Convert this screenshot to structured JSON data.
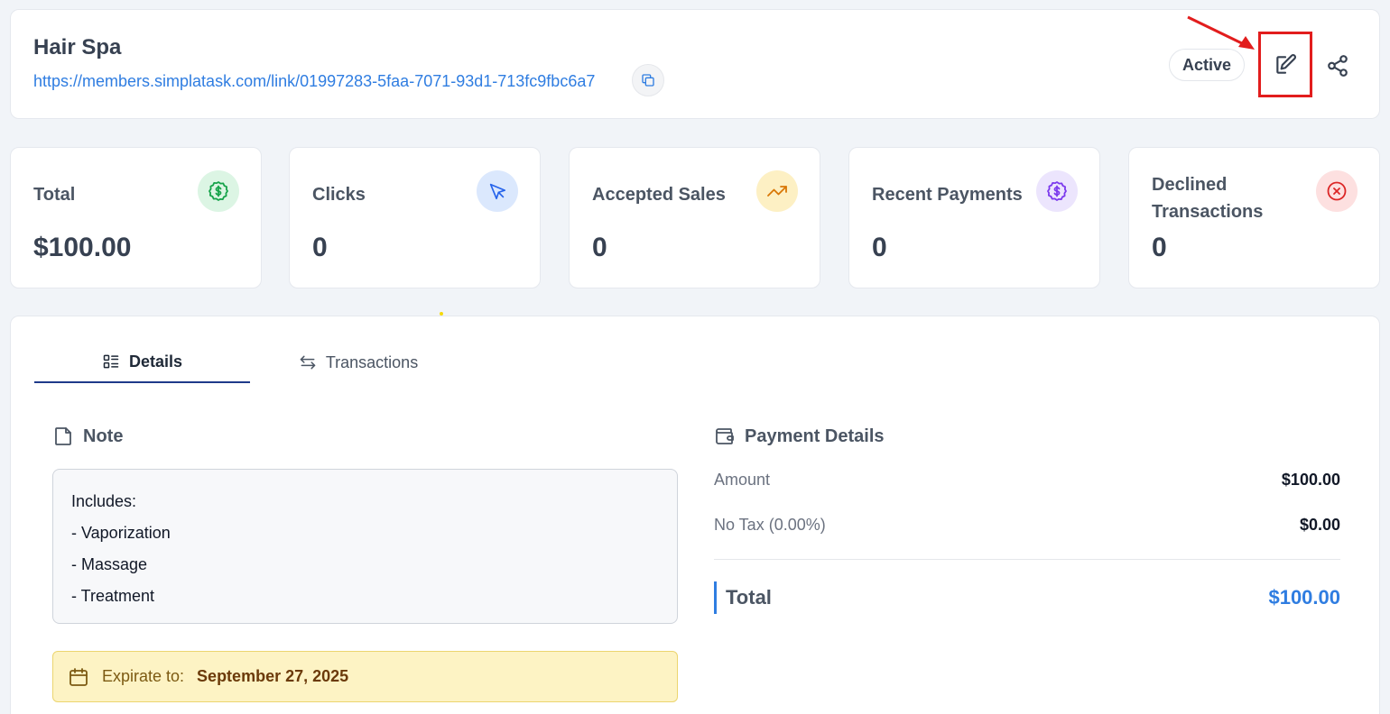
{
  "header": {
    "title": "Hair Spa",
    "link": "https://members.simplatask.com/link/01997283-5faa-7071-93d1-713fc9fbc6a7",
    "status": "Active"
  },
  "stats": [
    {
      "label": "Total",
      "value": "$100.00",
      "icon": "dollar-badge-icon",
      "color": "#16a34a",
      "bg": "#dcf5e4"
    },
    {
      "label": "Clicks",
      "value": "0",
      "icon": "cursor-icon",
      "color": "#2563eb",
      "bg": "#dbe8fd"
    },
    {
      "label": "Accepted Sales",
      "value": "0",
      "icon": "trending-up-icon",
      "color": "#d97706",
      "bg": "#fdf0c4"
    },
    {
      "label": "Recent Payments",
      "value": "0",
      "icon": "dollar-badge-icon",
      "color": "#7c3aed",
      "bg": "#ece5fd"
    },
    {
      "label_line1": "Declined",
      "label_line2": "Transactions",
      "value": "0",
      "icon": "x-circle-icon",
      "color": "#dc2626",
      "bg": "#fde0e0"
    }
  ],
  "tabs": {
    "details": "Details",
    "transactions": "Transactions"
  },
  "note": {
    "title": "Note",
    "lines": [
      "Includes:",
      "- Vaporization",
      "- Massage",
      "- Treatment"
    ]
  },
  "expiration": {
    "label": "Expirate to:",
    "date": "September 27, 2025"
  },
  "payment": {
    "title": "Payment Details",
    "amount_label": "Amount",
    "amount_value": "$100.00",
    "tax_label": "No Tax (0.00%)",
    "tax_value": "$0.00",
    "total_label": "Total",
    "total_value": "$100.00"
  }
}
